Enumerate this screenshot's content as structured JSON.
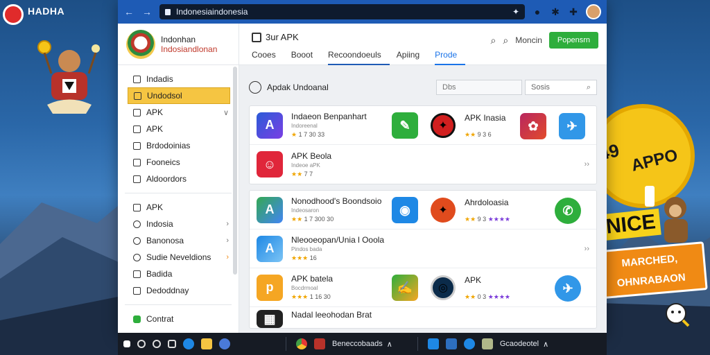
{
  "brand": {
    "title": "HADHA",
    "subtitle": ""
  },
  "browser": {
    "url": "Indonesiaindonesia",
    "back": "←",
    "forward": "→"
  },
  "site": {
    "name_line1": "Indonhan",
    "name_line2": "Indosiandlonan"
  },
  "header": {
    "title": "3ur APK",
    "tabs": [
      "Cooes",
      "Booot",
      "Recoondoeuls",
      "Apiing",
      "Prode"
    ],
    "link": "Moncin",
    "button": "Popensrn"
  },
  "sidebar": {
    "group1": [
      {
        "label": "Indadis"
      },
      {
        "label": "Undodsol"
      },
      {
        "label": "APK"
      },
      {
        "label": "APK"
      },
      {
        "label": "Brdodoinias"
      },
      {
        "label": "Fooneics"
      },
      {
        "label": "Aldoordors"
      }
    ],
    "group2": [
      {
        "label": "APK"
      },
      {
        "label": "Indosia"
      },
      {
        "label": "Banonosa"
      },
      {
        "label": "Sudie Neveldions"
      },
      {
        "label": "Badida"
      },
      {
        "label": "Dedoddnay"
      }
    ],
    "footer": {
      "label": "Contrat"
    }
  },
  "content": {
    "title": "Apdak Undoanal",
    "filter_placeholder": "Dbs",
    "search_placeholder": "Sosis"
  },
  "apps": [
    {
      "name": "Indaeon Benpanhart",
      "sub": "Indoreenal",
      "rating": "1 7 30 33"
    },
    {
      "name": "APK Beola",
      "sub": "Indeoe aPK",
      "rating": "7 7"
    },
    {
      "name": "Nonodhood's Boondsoio",
      "sub": "Indeosaron",
      "rating": "1 7 300 30"
    },
    {
      "name": "Nleooeopan/Unia l Ooola",
      "sub": "Pindos bada",
      "rating": "16"
    },
    {
      "name": "APK batela",
      "sub": "Bocdrmoal",
      "rating": "1 16 30"
    },
    {
      "name": "Nadal leeohodan Brat",
      "sub": "",
      "rating": ""
    }
  ],
  "mid_apps": [
    {
      "name": "APK Inasia",
      "rating": "9 3 6"
    },
    {
      "name": "Ahrdoloasia",
      "rating": "9 3"
    },
    {
      "name": "APK",
      "rating": "0 3"
    }
  ],
  "badges": {
    "apk_badge": "APPO",
    "num_badge": "49",
    "nice": "NICE",
    "ribbon_line1": "MARCHED,",
    "ribbon_line2": "OHNRABAON"
  },
  "taskbar": {
    "label1": "Beneccobaads",
    "label2": "Gcaodeotel"
  },
  "chevrons": {
    "down": "∨",
    "right": "›",
    "double_right": "››"
  },
  "colors": {
    "accent": "#1e5bb5",
    "highlight": "#f5c542",
    "primary_button": "#2eae3c"
  }
}
